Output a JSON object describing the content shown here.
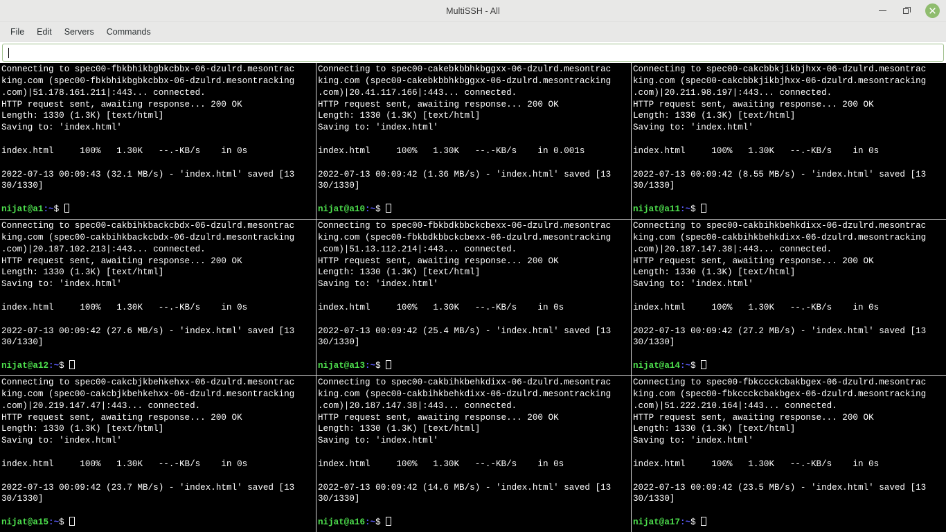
{
  "window": {
    "title": "MultiSSH - All",
    "controls": {
      "minimize": "minimize",
      "maximize": "maximize",
      "close": "close"
    },
    "close_color": "#8fbc6e"
  },
  "menubar": {
    "items": [
      {
        "label": "File"
      },
      {
        "label": "Edit"
      },
      {
        "label": "Servers"
      },
      {
        "label": "Commands"
      }
    ]
  },
  "command_input": {
    "value": "",
    "placeholder": ""
  },
  "terminal_colors": {
    "background": "#000000",
    "foreground": "#ffffff",
    "prompt_user": "#4ee24e",
    "prompt_path": "#5c5cff",
    "divider": "#d8d8d8"
  },
  "panes": [
    {
      "host": "spec00-fbkbhikbgbkcbbx-06-dzulrd.mesontracking.com",
      "line1": "Connecting to spec00-fbkbhikbgbkcbbx-06-dzulrd.mesontrac",
      "line2": "king.com (spec00-fbkbhikbgbkcbbx-06-dzulrd.mesontracking",
      "line3": ".com)|51.178.161.211|:443... connected.",
      "line4": "HTTP request sent, awaiting response... 200 OK",
      "line5": "Length: 1330 (1.3K) [text/html]",
      "line6": "Saving to: 'index.html'",
      "progress": "index.html     100%   1.30K   --.-KB/s    in 0s",
      "saved_line_a": "2022-07-13 00:09:43 (32.1 MB/s) - 'index.html' saved [13",
      "saved_line_b": "30/1330]",
      "prompt_user": "nijat@a1",
      "prompt_path": ":~",
      "prompt_symbol": "$ "
    },
    {
      "host": "spec00-cakebkbbhkbggxx-06-dzulrd.mesontracking.com",
      "line1": "Connecting to spec00-cakebkbbhkbggxx-06-dzulrd.mesontrac",
      "line2": "king.com (spec00-cakebkbbhkbggxx-06-dzulrd.mesontracking",
      "line3": ".com)|20.41.117.166|:443... connected.",
      "line4": "HTTP request sent, awaiting response... 200 OK",
      "line5": "Length: 1330 (1.3K) [text/html]",
      "line6": "Saving to: 'index.html'",
      "progress": "index.html     100%   1.30K   --.-KB/s    in 0.001s",
      "saved_line_a": "2022-07-13 00:09:42 (1.36 MB/s) - 'index.html' saved [13",
      "saved_line_b": "30/1330]",
      "prompt_user": "nijat@a10",
      "prompt_path": ":~",
      "prompt_symbol": "$ "
    },
    {
      "host": "spec00-cakcbbkjikbjhxx-06-dzulrd.mesontracking.com",
      "line1": "Connecting to spec00-cakcbbkjikbjhxx-06-dzulrd.mesontrac",
      "line2": "king.com (spec00-cakcbbkjikbjhxx-06-dzulrd.mesontracking",
      "line3": ".com)|20.211.98.197|:443... connected.",
      "line4": "HTTP request sent, awaiting response... 200 OK",
      "line5": "Length: 1330 (1.3K) [text/html]",
      "line6": "Saving to: 'index.html'",
      "progress": "index.html     100%   1.30K   --.-KB/s    in 0s",
      "saved_line_a": "2022-07-13 00:09:42 (8.55 MB/s) - 'index.html' saved [13",
      "saved_line_b": "30/1330]",
      "prompt_user": "nijat@a11",
      "prompt_path": ":~",
      "prompt_symbol": "$ "
    },
    {
      "host": "spec00-cakbihkbackcbdx-06-dzulrd.mesontracking.com",
      "line1": "Connecting to spec00-cakbihkbackcbdx-06-dzulrd.mesontrac",
      "line2": "king.com (spec00-cakbihkbackcbdx-06-dzulrd.mesontracking",
      "line3": ".com)|20.187.102.213|:443... connected.",
      "line4": "HTTP request sent, awaiting response... 200 OK",
      "line5": "Length: 1330 (1.3K) [text/html]",
      "line6": "Saving to: 'index.html'",
      "progress": "index.html     100%   1.30K   --.-KB/s    in 0s",
      "saved_line_a": "2022-07-13 00:09:42 (27.6 MB/s) - 'index.html' saved [13",
      "saved_line_b": "30/1330]",
      "prompt_user": "nijat@a12",
      "prompt_path": ":~",
      "prompt_symbol": "$ "
    },
    {
      "host": "spec00-fbkbdkbbckcbexx-06-dzulrd.mesontracking.com",
      "line1": "Connecting to spec00-fbkbdkbbckcbexx-06-dzulrd.mesontrac",
      "line2": "king.com (spec00-fbkbdkbbckcbexx-06-dzulrd.mesontracking",
      "line3": ".com)|51.13.112.214|:443... connected.",
      "line4": "HTTP request sent, awaiting response... 200 OK",
      "line5": "Length: 1330 (1.3K) [text/html]",
      "line6": "Saving to: 'index.html'",
      "progress": "index.html     100%   1.30K   --.-KB/s    in 0s",
      "saved_line_a": "2022-07-13 00:09:42 (25.4 MB/s) - 'index.html' saved [13",
      "saved_line_b": "30/1330]",
      "prompt_user": "nijat@a13",
      "prompt_path": ":~",
      "prompt_symbol": "$ "
    },
    {
      "host": "spec00-cakbihkbehkdixx-06-dzulrd.mesontracking.com",
      "line1": "Connecting to spec00-cakbihkbehkdixx-06-dzulrd.mesontrac",
      "line2": "king.com (spec00-cakbihkbehkdixx-06-dzulrd.mesontracking",
      "line3": ".com)|20.187.147.38|:443... connected.",
      "line4": "HTTP request sent, awaiting response... 200 OK",
      "line5": "Length: 1330 (1.3K) [text/html]",
      "line6": "Saving to: 'index.html'",
      "progress": "index.html     100%   1.30K   --.-KB/s    in 0s",
      "saved_line_a": "2022-07-13 00:09:42 (27.2 MB/s) - 'index.html' saved [13",
      "saved_line_b": "30/1330]",
      "prompt_user": "nijat@a14",
      "prompt_path": ":~",
      "prompt_symbol": "$ "
    },
    {
      "host": "spec00-cakcbjkbehkehxx-06-dzulrd.mesontracking.com",
      "line1": "Connecting to spec00-cakcbjkbehkehxx-06-dzulrd.mesontrac",
      "line2": "king.com (spec00-cakcbjkbehkehxx-06-dzulrd.mesontracking",
      "line3": ".com)|20.219.147.47|:443... connected.",
      "line4": "HTTP request sent, awaiting response... 200 OK",
      "line5": "Length: 1330 (1.3K) [text/html]",
      "line6": "Saving to: 'index.html'",
      "progress": "index.html     100%   1.30K   --.-KB/s    in 0s",
      "saved_line_a": "2022-07-13 00:09:42 (23.7 MB/s) - 'index.html' saved [13",
      "saved_line_b": "30/1330]",
      "prompt_user": "nijat@a15",
      "prompt_path": ":~",
      "prompt_symbol": "$ "
    },
    {
      "host": "spec00-cakbihkbehkdixx-06-dzulrd.mesontracking.com",
      "line1": "Connecting to spec00-cakbihkbehkdixx-06-dzulrd.mesontrac",
      "line2": "king.com (spec00-cakbihkbehkdixx-06-dzulrd.mesontracking",
      "line3": ".com)|20.187.147.38|:443... connected.",
      "line4": "HTTP request sent, awaiting response... 200 OK",
      "line5": "Length: 1330 (1.3K) [text/html]",
      "line6": "Saving to: 'index.html'",
      "progress": "index.html     100%   1.30K   --.-KB/s    in 0s",
      "saved_line_a": "2022-07-13 00:09:42 (14.6 MB/s) - 'index.html' saved [13",
      "saved_line_b": "30/1330]",
      "prompt_user": "nijat@a16",
      "prompt_path": ":~",
      "prompt_symbol": "$ "
    },
    {
      "host": "spec00-fbkccckcbakbgex-06-dzulrd.mesontracking.com",
      "line1": "Connecting to spec00-fbkccckcbakbgex-06-dzulrd.mesontrac",
      "line2": "king.com (spec00-fbkccckcbakbgex-06-dzulrd.mesontracking",
      "line3": ".com)|51.222.210.164|:443... connected.",
      "line4": "HTTP request sent, awaiting response... 200 OK",
      "line5": "Length: 1330 (1.3K) [text/html]",
      "line6": "Saving to: 'index.html'",
      "progress": "index.html     100%   1.30K   --.-KB/s    in 0s",
      "saved_line_a": "2022-07-13 00:09:42 (23.5 MB/s) - 'index.html' saved [13",
      "saved_line_b": "30/1330]",
      "prompt_user": "nijat@a17",
      "prompt_path": ":~",
      "prompt_symbol": "$ "
    }
  ]
}
